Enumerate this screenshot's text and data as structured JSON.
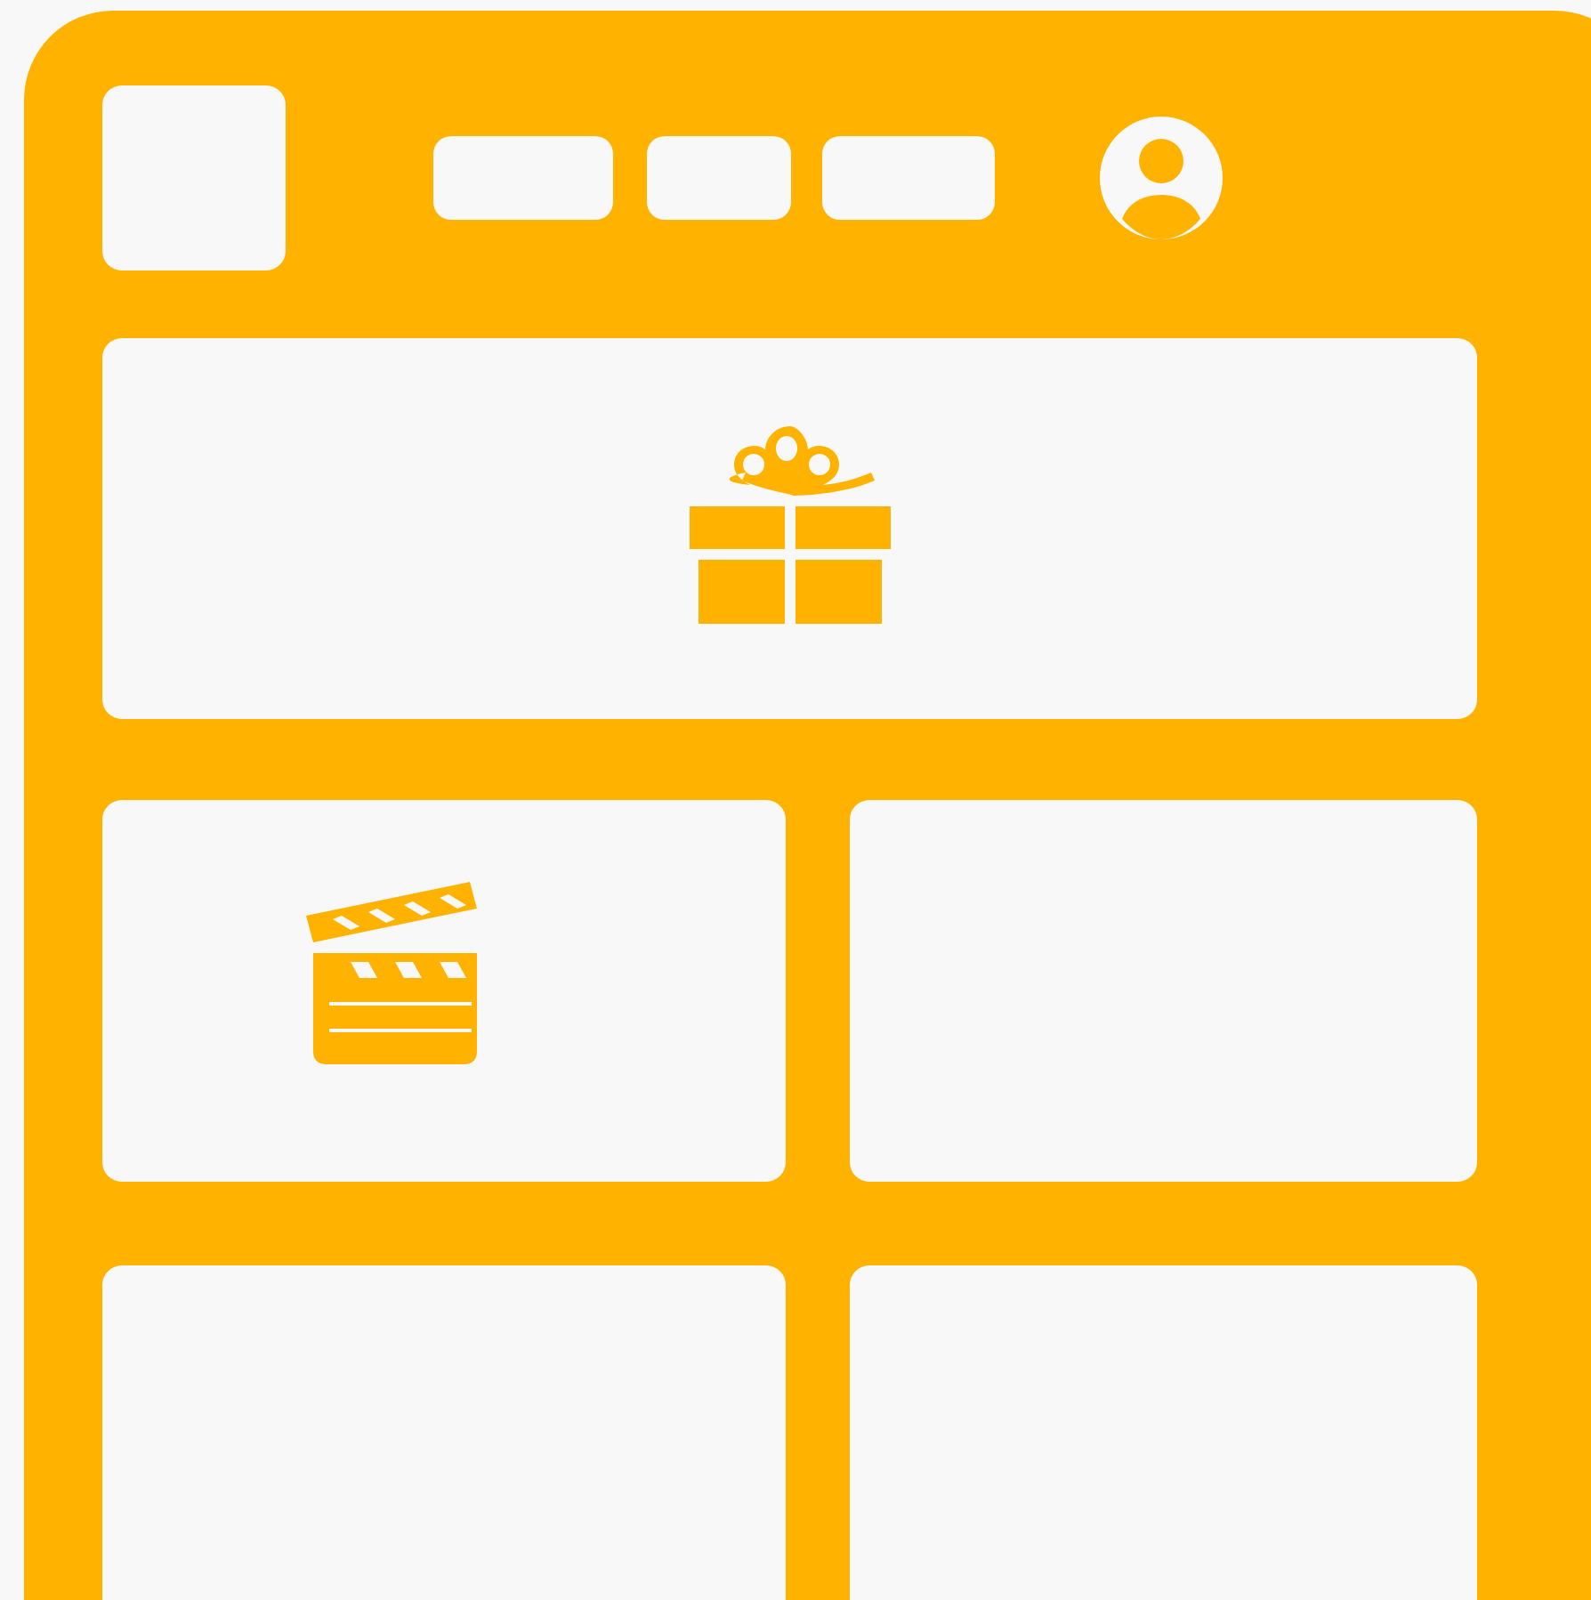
{
  "hero": {
    "kind": "gift"
  },
  "cards": [
    {
      "kind": "video"
    },
    {
      "kind": "blank"
    },
    {
      "kind": "blank"
    },
    {
      "kind": "blank"
    }
  ]
}
